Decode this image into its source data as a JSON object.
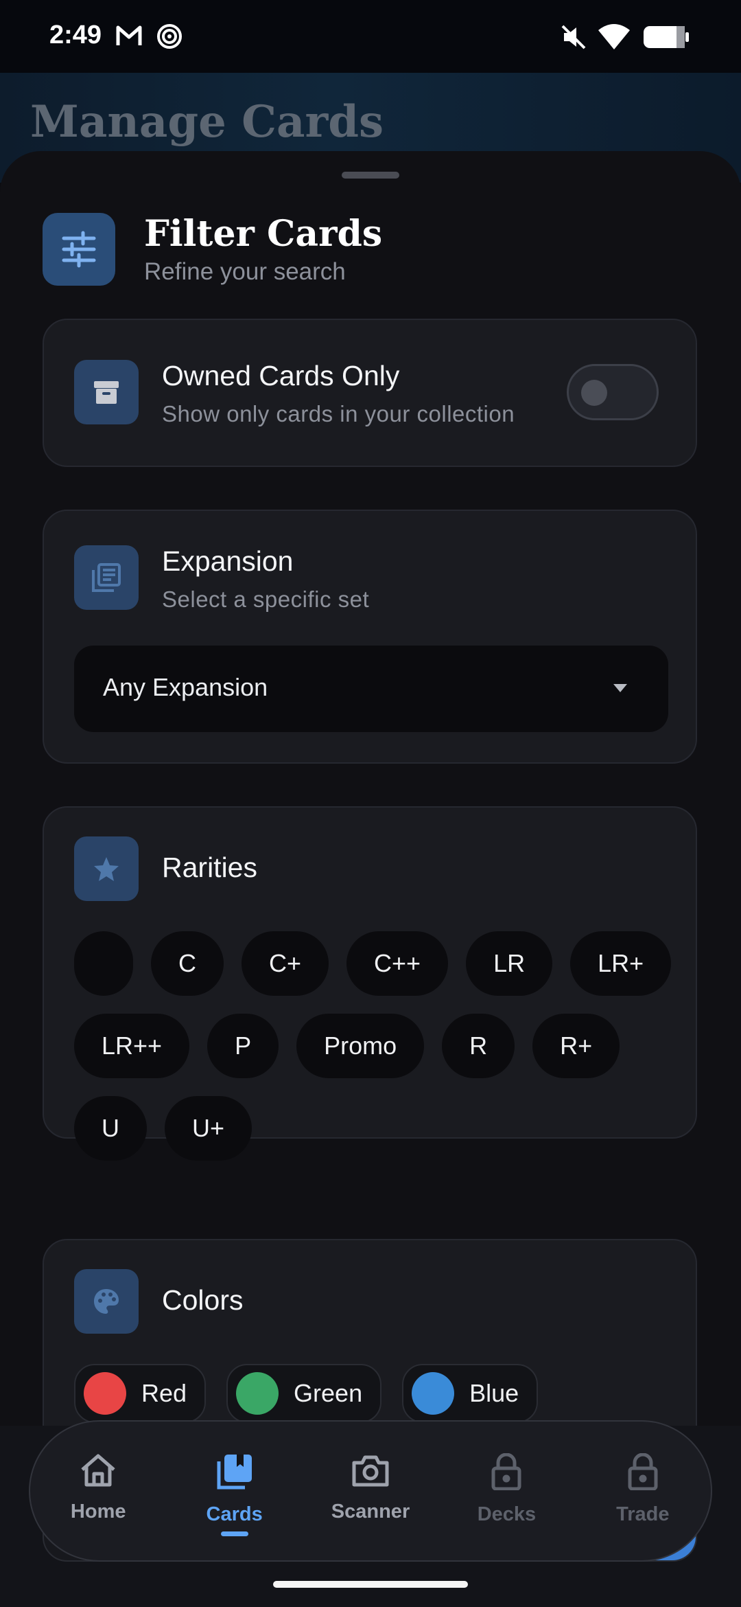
{
  "status_bar": {
    "time": "2:49"
  },
  "background_page": {
    "title": "Manage Cards"
  },
  "sheet": {
    "title": "Filter Cards",
    "subtitle": "Refine your search",
    "owned": {
      "title": "Owned Cards Only",
      "subtitle": "Show only cards in your collection",
      "enabled": false
    },
    "expansion": {
      "title": "Expansion",
      "subtitle": "Select a specific set",
      "selected": "Any Expansion"
    },
    "rarities": {
      "title": "Rarities",
      "chips": [
        "",
        "C",
        "C+",
        "C++",
        "LR",
        "LR+",
        "LR++",
        "P",
        "Promo",
        "R",
        "R+",
        "U",
        "U+"
      ]
    },
    "colors": {
      "title": "Colors",
      "items": [
        {
          "label": "Red",
          "color": "#e84545"
        },
        {
          "label": "Green",
          "color": "#3aa766"
        },
        {
          "label": "Blue",
          "color": "#3a8bd8"
        }
      ]
    }
  },
  "nav": {
    "items": [
      {
        "label": "Home",
        "icon": "home-icon",
        "state": "normal"
      },
      {
        "label": "Cards",
        "icon": "cards-icon",
        "state": "active"
      },
      {
        "label": "Scanner",
        "icon": "camera-icon",
        "state": "normal"
      },
      {
        "label": "Decks",
        "icon": "lock-icon",
        "state": "locked"
      },
      {
        "label": "Trade",
        "icon": "lock-icon",
        "state": "locked"
      }
    ]
  }
}
